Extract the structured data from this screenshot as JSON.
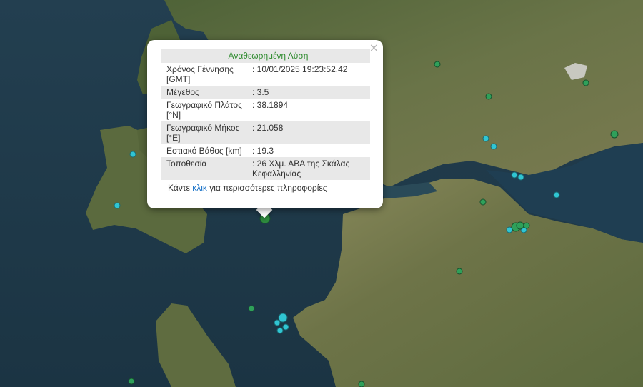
{
  "popup": {
    "title": "Αναθεωρημένη Λύση",
    "close_label": "×",
    "rows": [
      {
        "label": "Χρόνος Γέννησης [GMT]",
        "value": ": 10/01/2025 19:23:52.42"
      },
      {
        "label": "Μέγεθος",
        "value": ": 3.5"
      },
      {
        "label": "Γεωγραφικό Πλάτος [°N]",
        "value": ": 38.1894"
      },
      {
        "label": "Γεωγραφικό Μήκος [°E]",
        "value": ": 21.058"
      },
      {
        "label": "Εστιακό Βάθος [km]",
        "value": ": 19.3"
      },
      {
        "label": "Τοποθεσία",
        "value": ": 26 Χλμ. ΑΒΑ της Σκάλας Κεφαλληνίας"
      }
    ],
    "footer_prefix": "Κάντε ",
    "footer_link": "κλικ",
    "footer_suffix": " για περισσότερες πληροφορίες"
  },
  "colors": {
    "sea": "#1f3a4a",
    "land": "#5a6a3a",
    "recent_event": "#30c5d3",
    "older_event": "#2fa05a",
    "selected_event": "#2e8b3e",
    "title_green": "#2e8b2e",
    "link_blue": "#1a73c8"
  }
}
